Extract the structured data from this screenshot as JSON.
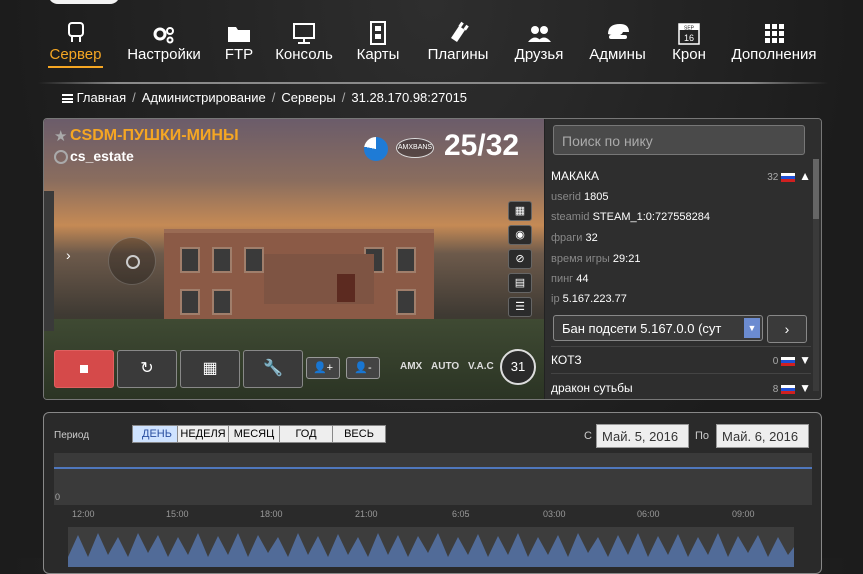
{
  "nav": {
    "items": [
      {
        "label": "Сервер",
        "icon": "server-icon",
        "active": true
      },
      {
        "label": "Настройки",
        "icon": "gears-icon"
      },
      {
        "label": "FTP",
        "icon": "folder-icon"
      },
      {
        "label": "Консоль",
        "icon": "monitor-icon"
      },
      {
        "label": "Карты",
        "icon": "film-icon"
      },
      {
        "label": "Плагины",
        "icon": "plugin-icon"
      },
      {
        "label": "Друзья",
        "icon": "friends-icon"
      },
      {
        "label": "Админы",
        "icon": "admin-cap-icon"
      },
      {
        "label": "Крон",
        "icon": "calendar-icon"
      },
      {
        "label": "Дополнения",
        "icon": "grid-icon"
      }
    ],
    "calendar_icon_month": "SEP",
    "calendar_icon_day": "16"
  },
  "breadcrumb": {
    "items": [
      "Главная",
      "Администрирование",
      "Серверы",
      "31.28.170.98:27015"
    ]
  },
  "server": {
    "name": "CSDM-ПУШКИ-МИНЫ",
    "map": "cs_estate",
    "players": "25/32",
    "amx_label": "AMXBANS",
    "badges": [
      "AMX",
      "AUTO",
      "V.A.C"
    ],
    "counter": "31"
  },
  "sidebar": {
    "search_placeholder": "Поиск по нику",
    "expanded_player": {
      "name": "МАКАКА",
      "count": "32",
      "fields": [
        {
          "k": "userid",
          "v": "1805"
        },
        {
          "k": "steamid",
          "v": "STEAM_1:0:727558284"
        },
        {
          "k": "фраги",
          "v": "32"
        },
        {
          "k": "время игры",
          "v": "29:21"
        },
        {
          "k": "пинг",
          "v": "44"
        },
        {
          "k": "ip",
          "v": "5.167.223.77"
        }
      ],
      "action_select": "Бан подсети 5.167.0.0 (сут"
    },
    "players": [
      {
        "name": "КОТЗ",
        "count": "0"
      },
      {
        "name": "дракон сутьбы",
        "count": "8"
      }
    ]
  },
  "stats": {
    "period_label": "Период",
    "tabs": [
      "ДЕНЬ",
      "НЕДЕЛЯ",
      "МЕСЯЦ",
      "ГОД",
      "ВЕСЬ"
    ],
    "active_tab": "ДЕНЬ",
    "from_label": "С",
    "to_label": "По",
    "from_value": "Май. 5, 2016",
    "to_value": "Май. 6, 2016",
    "y_zero": "0",
    "x_ticks": [
      "12:00",
      "15:00",
      "18:00",
      "21:00",
      "6:05",
      "03:00",
      "06:00",
      "09:00"
    ]
  },
  "chart_data": {
    "type": "line",
    "x": [
      "12:00",
      "15:00",
      "18:00",
      "21:00",
      "6:05",
      "03:00",
      "06:00",
      "09:00"
    ],
    "series": [
      {
        "values": [
          25,
          25,
          25,
          25,
          25,
          25,
          25,
          25
        ]
      }
    ],
    "ylabel": "",
    "xlabel": ""
  },
  "colors": {
    "accent": "#f5a623",
    "stop_button": "#d54a4a",
    "chart_line": "#4f77bd"
  }
}
